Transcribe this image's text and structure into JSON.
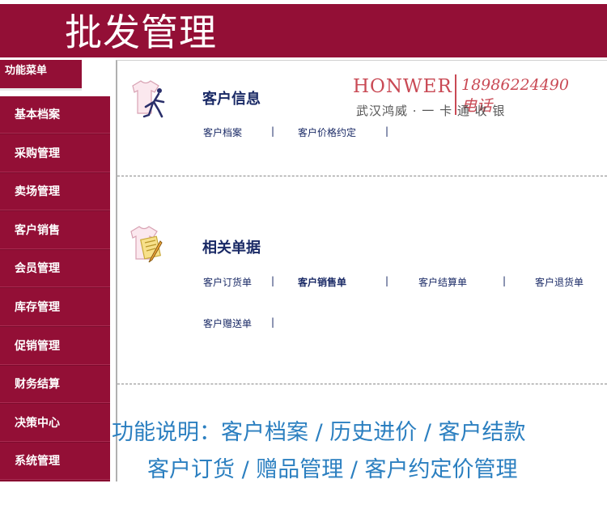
{
  "header": {
    "title": "批发管理"
  },
  "menu_tab": {
    "label": "功能菜单"
  },
  "sidebar": {
    "items": [
      {
        "label": "基本档案"
      },
      {
        "label": "采购管理"
      },
      {
        "label": "卖场管理"
      },
      {
        "label": "客户销售"
      },
      {
        "label": "会员管理"
      },
      {
        "label": "库存管理"
      },
      {
        "label": "促销管理"
      },
      {
        "label": "财务结算"
      },
      {
        "label": "决策中心"
      },
      {
        "label": "系统管理"
      }
    ]
  },
  "logo": {
    "brand": "HONWER",
    "phone": "18986224490电话",
    "tagline": "武汉鸿威 · 一 卡 通 收 银"
  },
  "sections": [
    {
      "title": "客户信息",
      "icon": "shirt-person-icon",
      "links": [
        "客户档案",
        "客户价格约定"
      ]
    },
    {
      "title": "相关单据",
      "icon": "shirt-document-icon",
      "links": [
        "客户订货单",
        "客户销售单",
        "客户结算单",
        "客户退货单",
        "客户赠送单"
      ]
    }
  ],
  "separator": "|",
  "description": {
    "line1": "功能说明：客户档案 / 历史进价 / 客户结款",
    "line2": "客户订货 / 赠品管理 / 客户约定价管理"
  },
  "colors": {
    "brand": "#930f36",
    "link": "#1a2a66",
    "description": "#2b7fc0",
    "logo": "#c94a55"
  }
}
